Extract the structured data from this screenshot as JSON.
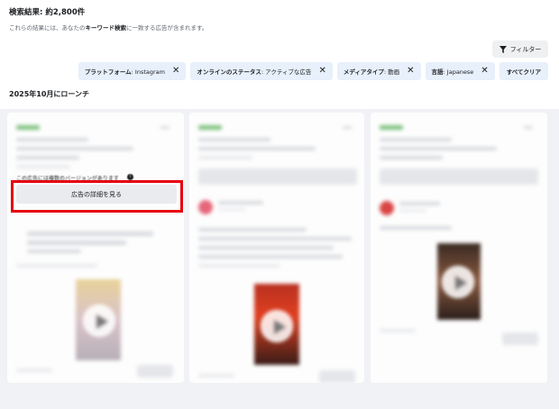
{
  "header": {
    "results_title": "検索結果: 約2,800件",
    "desc_before": "これらの結果には、あなたの",
    "desc_keyword": "キーワード検索",
    "desc_after": "に一致する広告が含まれます。"
  },
  "filter_button": {
    "label": "フィルター",
    "icon": "filter-icon"
  },
  "chips": [
    {
      "key": "プラットフォーム",
      "value": ": Instagram"
    },
    {
      "key": "オンラインのステータス",
      "value": ": アクティブな広告"
    },
    {
      "key": "メディアタイプ",
      "value": ": 動画"
    },
    {
      "key": "言語",
      "value": ": Japanese"
    }
  ],
  "clear_all": "すべてクリア",
  "launch_label": "2025年10月にローンチ",
  "card1": {
    "versions_text": "この広告には複数のバージョンがあります",
    "detail_button": "広告の詳細を見る"
  },
  "colors": {
    "highlight": "#e5000b",
    "chip_bg": "#e7f0fb",
    "grid_bg": "#f0f2f5"
  }
}
